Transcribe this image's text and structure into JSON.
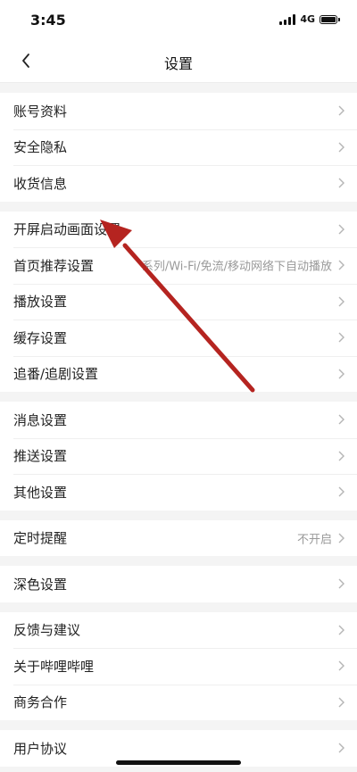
{
  "status_bar": {
    "time": "3:45",
    "network": "4G"
  },
  "nav": {
    "title": "设置"
  },
  "groups": [
    {
      "rows": [
        {
          "label": "账号资料"
        },
        {
          "label": "安全隐私"
        },
        {
          "label": "收货信息"
        }
      ]
    },
    {
      "rows": [
        {
          "label": "开屏启动画面设置"
        },
        {
          "label": "首页推荐设置",
          "value": "系列/Wi-Fi/免流/移动网络下自动播放"
        },
        {
          "label": "播放设置"
        },
        {
          "label": "缓存设置"
        },
        {
          "label": "追番/追剧设置"
        }
      ]
    },
    {
      "rows": [
        {
          "label": "消息设置"
        },
        {
          "label": "推送设置"
        },
        {
          "label": "其他设置"
        }
      ]
    },
    {
      "rows": [
        {
          "label": "定时提醒",
          "value": "不开启"
        }
      ]
    },
    {
      "rows": [
        {
          "label": "深色设置"
        }
      ]
    },
    {
      "rows": [
        {
          "label": "反馈与建议"
        },
        {
          "label": "关于哔哩哔哩"
        },
        {
          "label": "商务合作"
        }
      ]
    },
    {
      "rows": [
        {
          "label": "用户协议"
        }
      ]
    }
  ],
  "annotation": {
    "arrow_color": "#b52420"
  }
}
